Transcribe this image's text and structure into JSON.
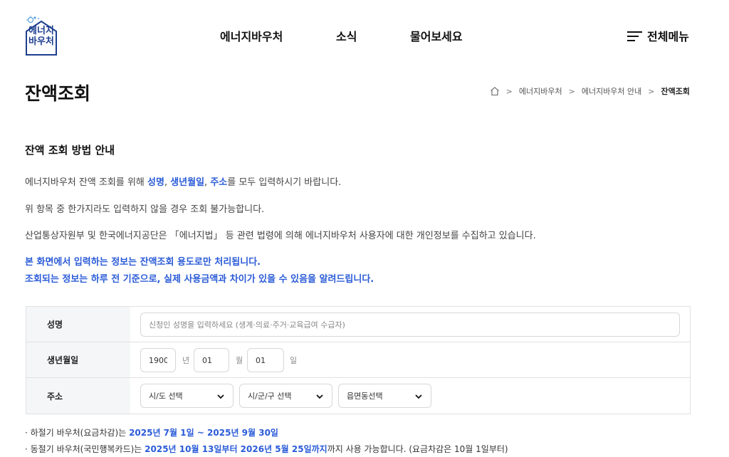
{
  "logo": {
    "line1": "에너지",
    "line2": "바우처"
  },
  "nav": {
    "items": [
      "에너지바우처",
      "소식",
      "물어보세요"
    ],
    "all_menu": "전체메뉴"
  },
  "page": {
    "title": "잔액조회"
  },
  "breadcrumb": {
    "items": [
      "에너지바우처",
      "에너지바우처 안내"
    ],
    "current": "잔액조회"
  },
  "guide": {
    "title": "잔액 조회 방법 안내",
    "line1": {
      "before": "에너지바우처 잔액 조회를 위해 ",
      "f1": "성명",
      "c1": ", ",
      "f2": "생년월일",
      "c2": ", ",
      "f3": "주소",
      "after": "를 모두 입력하시기 바랍니다."
    },
    "line2": "위 항목 중 한가지라도 입력하지 않을 경우 조회 불가능합니다.",
    "line3": "산업통상자원부 및 한국에너지공단은 「에너지법」 등 관련 법령에 의해 에너지바우처 사용자에 대한 개인정보를 수집하고 있습니다.",
    "line4": "본 화면에서 입력하는 정보는 잔액조회 용도로만 처리됩니다.",
    "line5": "조회되는 정보는 하루 전 기준으로, 실제 사용금액과 차이가 있을 수 있음을 알려드립니다."
  },
  "form": {
    "name": {
      "label": "성명",
      "placeholder": "신청인 성명을 입력하세요 (생계·의료·주거·교육급여 수급자)"
    },
    "birth": {
      "label": "생년월일",
      "year": "1900",
      "year_unit": "년",
      "month": "01",
      "month_unit": "월",
      "day": "01",
      "day_unit": "일"
    },
    "address": {
      "label": "주소",
      "sido": "시/도 선택",
      "sigungu": "시/군/구 선택",
      "eupmyeon": "읍면동선택"
    }
  },
  "notes": {
    "summer": {
      "prefix": "· 하절기 바우처(요금차감)는 ",
      "period": "2025년 7월 1일 ~ 2025년 9월 30일"
    },
    "winter": {
      "prefix": "· 동절기 바우처(국민행복카드)는 ",
      "period": "2025년 10월 13일부터 2026년 5월 25일까지",
      "suffix": "까지 사용 가능합니다. (요금차감은 10월 1일부터)"
    }
  },
  "colors": {
    "accent": "#2a5bd7",
    "header_cell": "#f5f6f8",
    "border": "#e1e1e1",
    "logo": "#1d3d8f"
  }
}
